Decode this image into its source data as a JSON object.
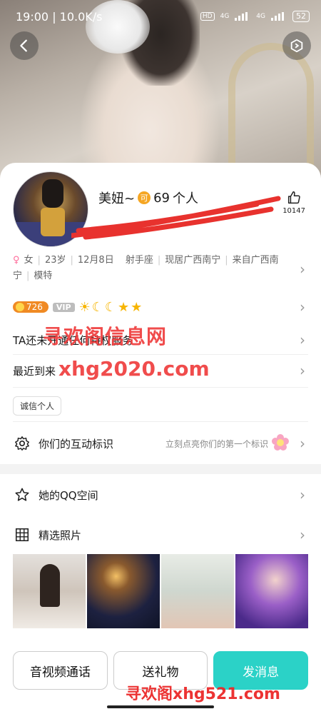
{
  "status_bar": {
    "time": "19:00 | 10.0K/s",
    "network_a": "HD",
    "signal_1": "4G",
    "signal_2": "4G",
    "battery": "52"
  },
  "header": {
    "back_icon": "back-arrow-icon",
    "more_icon": "hexagon-settings-icon"
  },
  "profile": {
    "name_prefix": "美妞~",
    "badge_char": "可",
    "name_suffix": "69",
    "name_tail": "个人",
    "likes": "10147",
    "info_line": {
      "gender": "女",
      "age": "23岁",
      "birthday": "12月8日",
      "zodiac": "射手座",
      "residence": "现居广西南宁",
      "hometown": "来自广西南宁",
      "job": "模特"
    },
    "level": "726",
    "vip_label": "VIP"
  },
  "rows": {
    "vip_service": "TA还未开通任何特权服务",
    "recent": "最近到来"
  },
  "tag_label": "诚信个人",
  "interaction": {
    "label": "你们的互动标识",
    "hint": "立刻点亮你们的第一个标识"
  },
  "qq_space": "她的QQ空间",
  "photos_title": "精选照片",
  "photos": [
    "photo-1",
    "photo-2",
    "photo-3",
    "photo-4"
  ],
  "actions": {
    "call": "音视频通话",
    "gift": "送礼物",
    "message": "发消息"
  },
  "watermarks": {
    "wm_site_name": "寻欢阁信息网",
    "wm_url": "xhg2020.com",
    "wm_bottom": "寻欢阁xhg521.com"
  },
  "colors": {
    "accent": "#2bd2c7",
    "level": "#f08a24",
    "watermark": "#ee3838"
  }
}
